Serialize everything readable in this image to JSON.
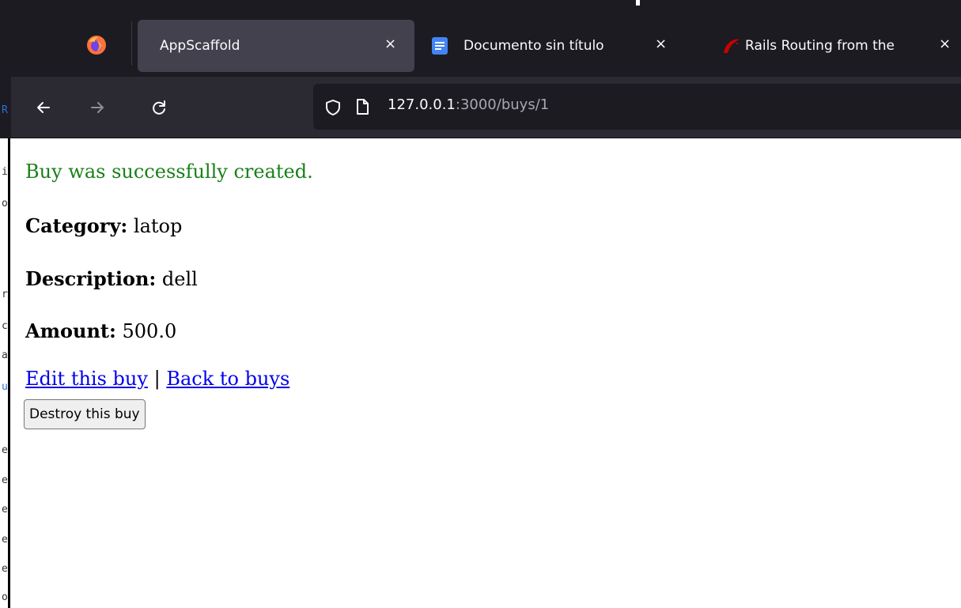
{
  "browser": {
    "tabs": [
      {
        "label": "AppScaffold",
        "active": true
      },
      {
        "label": "Documento sin título",
        "active": false
      },
      {
        "label": "Rails Routing from the",
        "active": false
      }
    ],
    "tab_close_glyph": "×",
    "url": {
      "host": "127.0.0.1",
      "rest": ":3000/buys/1"
    },
    "icons": {
      "app": "firefox-icon",
      "back": "back-arrow-icon",
      "forward": "forward-arrow-icon",
      "reload": "reload-icon",
      "shield": "shield-icon",
      "page": "page-icon",
      "docs_favicon": "google-docs-icon",
      "rails_favicon": "rails-icon"
    },
    "colors": {
      "tabbar_bg": "#1c1b22",
      "active_tab_bg": "#42414d",
      "toolbar_bg": "#2b2a33",
      "urlbar_bg": "#1c1b22",
      "docs_blue": "#4285f4",
      "rails_red": "#cc0000"
    }
  },
  "page": {
    "notice": "Buy was successfully created.",
    "fields": [
      {
        "label": "Category:",
        "value": "latop"
      },
      {
        "label": "Description:",
        "value": "dell"
      },
      {
        "label": "Amount:",
        "value": "500.0"
      }
    ],
    "links": {
      "edit": "Edit this buy",
      "separator": "|",
      "back": "Back to buys"
    },
    "destroy_button": "Destroy this buy",
    "colors": {
      "notice": "#198019",
      "link": "#0000ee"
    }
  }
}
